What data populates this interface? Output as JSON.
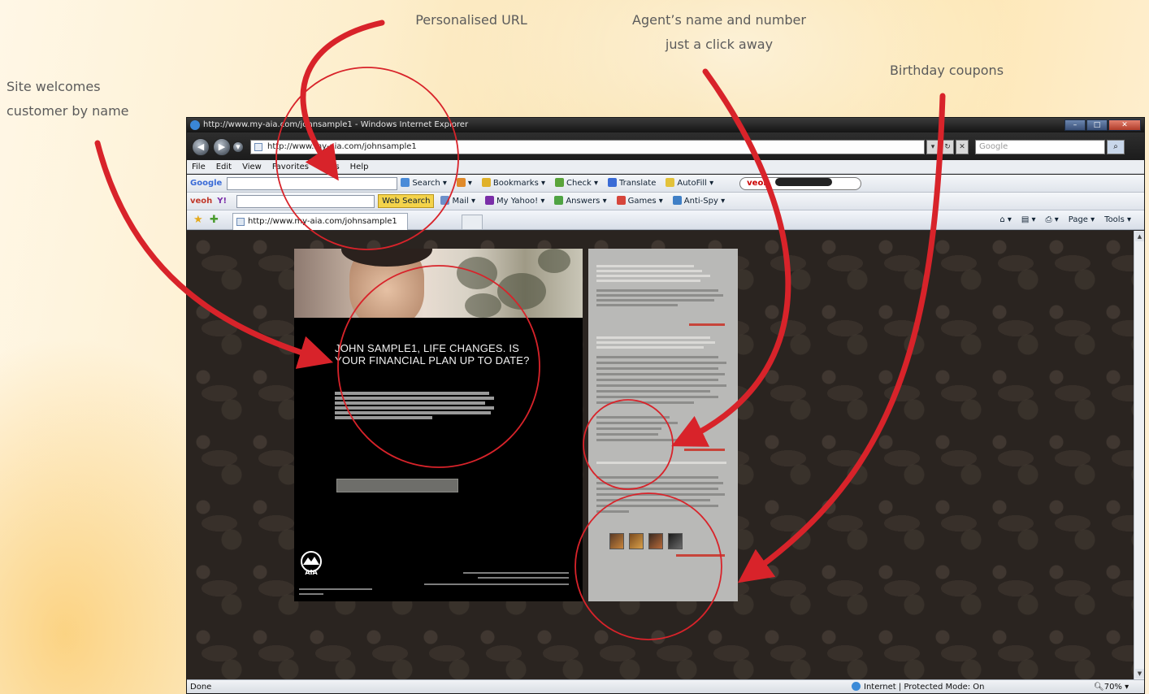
{
  "callouts": {
    "url": "Personalised URL",
    "agent_line1": "Agent’s name and number",
    "agent_line2": "just a click away",
    "birthday": "Birthday coupons",
    "welcome_line1": "Site welcomes",
    "welcome_line2": "customer by name"
  },
  "browser": {
    "title": "http://www.my-aia.com/johnsample1 - Windows Internet Explorer",
    "address": "http://www.my-aia.com/johnsample1",
    "search_placeholder": "Google",
    "menu": [
      "File",
      "Edit",
      "View",
      "Favorites",
      "Tools",
      "Help"
    ],
    "google_toolbar": {
      "brand": "Google",
      "items": [
        "Search",
        "Bookmarks",
        "Check",
        "Translate",
        "AutoFill"
      ]
    },
    "veoh_toolbar": {
      "brand": "veoh",
      "items": [
        "Web Search",
        "Mail",
        "My Yahoo!",
        "Answers",
        "Games",
        "Anti-Spy"
      ]
    },
    "veoh_badge": "veoh",
    "tab_title": "http://www.my-aia.com/johnsample1",
    "command_bar": [
      "Page",
      "Tools"
    ],
    "status": {
      "left": "Done",
      "zone": "Internet | Protected Mode: On",
      "zoom": "70%"
    }
  },
  "page": {
    "headline": "JOHN SAMPLE1, LIFE CHANGES. IS YOUR FINANCIAL PLAN UP TO DATE?",
    "brand_logo": "AIA"
  },
  "colors": {
    "annotation_red": "#d8232a",
    "callout_text": "#5b5b5b",
    "page_background": "#2a2420"
  }
}
